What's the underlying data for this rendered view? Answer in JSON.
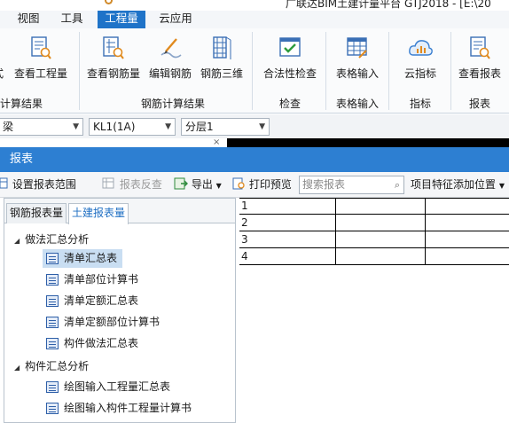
{
  "window_title": "广联达BIM土建计量平台 GTJ2018 - [E:\\20",
  "menu_tabs": [
    "视图",
    "工具",
    "工程量",
    "云应用"
  ],
  "active_menu_tab": "工程量",
  "ribbon": {
    "buttons": [
      {
        "label": "式",
        "icon": "formula-icon"
      },
      {
        "label": "查看工程量",
        "icon": "view-quantity-icon"
      },
      {
        "label": "查看钢筋量",
        "icon": "view-rebar-icon"
      },
      {
        "label": "编辑钢筋",
        "icon": "edit-rebar-icon"
      },
      {
        "label": "钢筋三维",
        "icon": "rebar-3d-icon"
      },
      {
        "label": "合法性检查",
        "icon": "validity-check-icon"
      },
      {
        "label": "表格输入",
        "icon": "table-input-icon"
      },
      {
        "label": "云指标",
        "icon": "cloud-index-icon"
      },
      {
        "label": "查看报表",
        "icon": "view-report-icon"
      }
    ],
    "groups": [
      "计算结果",
      "钢筋计算结果",
      "检查",
      "表格输入",
      "指标",
      "报表"
    ]
  },
  "selectors": [
    {
      "value": "梁"
    },
    {
      "value": "KL1(1A)"
    },
    {
      "value": "分层1"
    }
  ],
  "dialog": {
    "title": "报表",
    "toolbar": {
      "setup_range": "设置报表范围",
      "reverse_lookup": "报表反查",
      "export": "导出",
      "print_preview": "打印预览",
      "search_placeholder": "搜索报表",
      "add_feature_position": "项目特征添加位置"
    },
    "tabs": [
      "钢筋报表量",
      "土建报表量"
    ],
    "active_tab": "土建报表量",
    "tree": [
      {
        "group": "做法汇总分析",
        "items": [
          "清单汇总表",
          "清单部位计算书",
          "清单定额汇总表",
          "清单定额部位计算书",
          "构件做法汇总表"
        ]
      },
      {
        "group": "构件汇总分析",
        "items": [
          "绘图输入工程量汇总表",
          "绘图输入构件工程量计算书"
        ]
      }
    ],
    "selected_item": "清单汇总表",
    "grid_rows": [
      "1",
      "2",
      "3",
      "4"
    ]
  }
}
